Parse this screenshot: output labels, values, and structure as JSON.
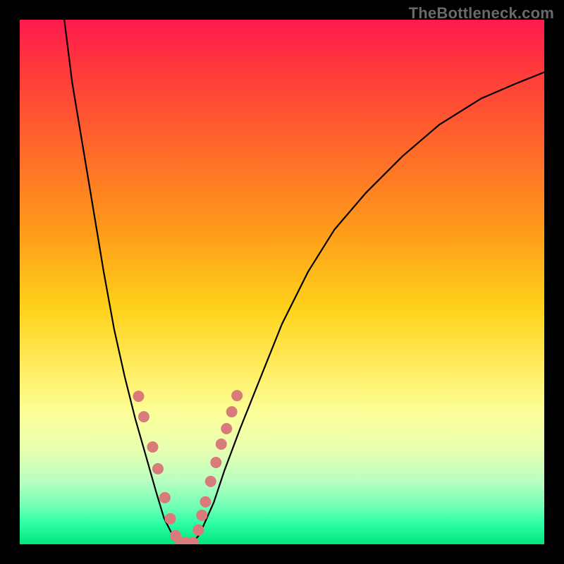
{
  "watermark": {
    "text": "TheBottleneck.com"
  },
  "chart_data": {
    "type": "line",
    "title": "",
    "xlabel": "",
    "ylabel": "",
    "xlim": [
      0,
      1
    ],
    "ylim": [
      0,
      1
    ],
    "series": [
      {
        "name": "bottleneck-curve",
        "x": [
          0.085,
          0.1,
          0.12,
          0.14,
          0.16,
          0.18,
          0.2,
          0.22,
          0.24,
          0.26,
          0.275,
          0.29,
          0.3,
          0.31,
          0.32,
          0.33,
          0.34,
          0.35,
          0.37,
          0.39,
          0.42,
          0.46,
          0.5,
          0.55,
          0.6,
          0.66,
          0.73,
          0.8,
          0.88,
          0.95,
          1.0
        ],
        "y": [
          1.0,
          0.88,
          0.76,
          0.64,
          0.52,
          0.41,
          0.32,
          0.24,
          0.17,
          0.1,
          0.05,
          0.02,
          0.005,
          0.0,
          0.0,
          0.005,
          0.015,
          0.035,
          0.08,
          0.14,
          0.22,
          0.32,
          0.42,
          0.52,
          0.6,
          0.67,
          0.74,
          0.8,
          0.85,
          0.88,
          0.9
        ]
      }
    ],
    "annotations": {
      "dots_color": "#d97b7b",
      "dots": [
        {
          "xn": 0.2265,
          "yn": 0.2821
        },
        {
          "xn": 0.2366,
          "yn": 0.2432
        },
        {
          "xn": 0.2534,
          "yn": 0.1855
        },
        {
          "xn": 0.2634,
          "yn": 0.1439
        },
        {
          "xn": 0.2768,
          "yn": 0.0889
        },
        {
          "xn": 0.2869,
          "yn": 0.0486
        },
        {
          "xn": 0.2969,
          "yn": 0.0164
        },
        {
          "xn": 0.307,
          "yn": 0.003
        },
        {
          "xn": 0.3171,
          "yn": 0.003
        },
        {
          "xn": 0.3305,
          "yn": 0.003
        },
        {
          "xn": 0.3405,
          "yn": 0.0271
        },
        {
          "xn": 0.3472,
          "yn": 0.0553
        },
        {
          "xn": 0.354,
          "yn": 0.0808
        },
        {
          "xn": 0.364,
          "yn": 0.1197
        },
        {
          "xn": 0.3741,
          "yn": 0.1559
        },
        {
          "xn": 0.3841,
          "yn": 0.1908
        },
        {
          "xn": 0.3942,
          "yn": 0.2204
        },
        {
          "xn": 0.4042,
          "yn": 0.2526
        },
        {
          "xn": 0.4143,
          "yn": 0.2835
        }
      ]
    },
    "background_gradient": {
      "direction": "top-to-bottom",
      "stops": [
        {
          "pos": 0.0,
          "color": "#ff1a4d"
        },
        {
          "pos": 0.25,
          "color": "#ff6a2a"
        },
        {
          "pos": 0.55,
          "color": "#ffd21a"
        },
        {
          "pos": 0.75,
          "color": "#fcff9a"
        },
        {
          "pos": 0.93,
          "color": "#6dffb5"
        },
        {
          "pos": 1.0,
          "color": "#00e67a"
        }
      ]
    }
  }
}
